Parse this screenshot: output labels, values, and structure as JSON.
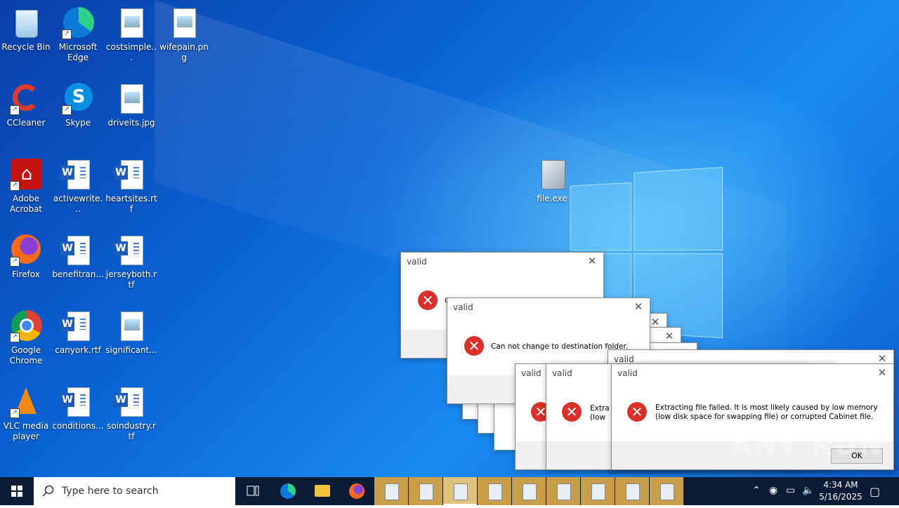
{
  "desktop_icons": [
    {
      "label": "Recycle Bin",
      "icon": "recycle-bin-icon"
    },
    {
      "label": "Microsoft Edge",
      "icon": "edge-icon"
    },
    {
      "label": "costsimple...",
      "icon": "image-file-icon"
    },
    {
      "label": "wifepain.png",
      "icon": "image-file-icon"
    },
    {
      "label": "CCleaner",
      "icon": "ccleaner-icon"
    },
    {
      "label": "Skype",
      "icon": "skype-icon"
    },
    {
      "label": "driveits.jpg",
      "icon": "image-file-icon"
    },
    {
      "label": "Adobe Acrobat",
      "icon": "acrobat-icon"
    },
    {
      "label": "activewrite...",
      "icon": "word-doc-icon"
    },
    {
      "label": "heartsites.rtf",
      "icon": "word-doc-icon"
    },
    {
      "label": "Firefox",
      "icon": "firefox-icon"
    },
    {
      "label": "benefitran...",
      "icon": "word-doc-icon"
    },
    {
      "label": "jerseyboth.rtf",
      "icon": "word-doc-icon"
    },
    {
      "label": "Google Chrome",
      "icon": "chrome-icon"
    },
    {
      "label": "canyork.rtf",
      "icon": "word-doc-icon"
    },
    {
      "label": "significant...",
      "icon": "image-file-icon"
    },
    {
      "label": "VLC media player",
      "icon": "vlc-icon"
    },
    {
      "label": "conditions...",
      "icon": "word-doc-icon"
    },
    {
      "label": "soindustry.rtf",
      "icon": "word-doc-icon"
    },
    {
      "label": "file.exe",
      "icon": "installer-icon"
    }
  ],
  "dialogs": {
    "title": "valid",
    "close_glyph": "✕",
    "dest_error": "Can not change to destination folder.",
    "dest_error_clipped": "C",
    "extract_error": "Extracting file failed.  It is most likely caused by low memory (low disk space for swapping file) or corrupted Cabinet file.",
    "extract_error_clipped_1": "Extra",
    "extract_error_clipped_2": "(low",
    "ok_label": "OK"
  },
  "taskbar": {
    "search_placeholder": "Type here to search",
    "time": "4:34 AM",
    "date": "5/16/2025",
    "app_buttons": 9
  },
  "watermark": "ANY RUN",
  "colors": {
    "taskbar": "#0b1b33",
    "error_red": "#d9302a",
    "task_app": "#c9a04a"
  }
}
